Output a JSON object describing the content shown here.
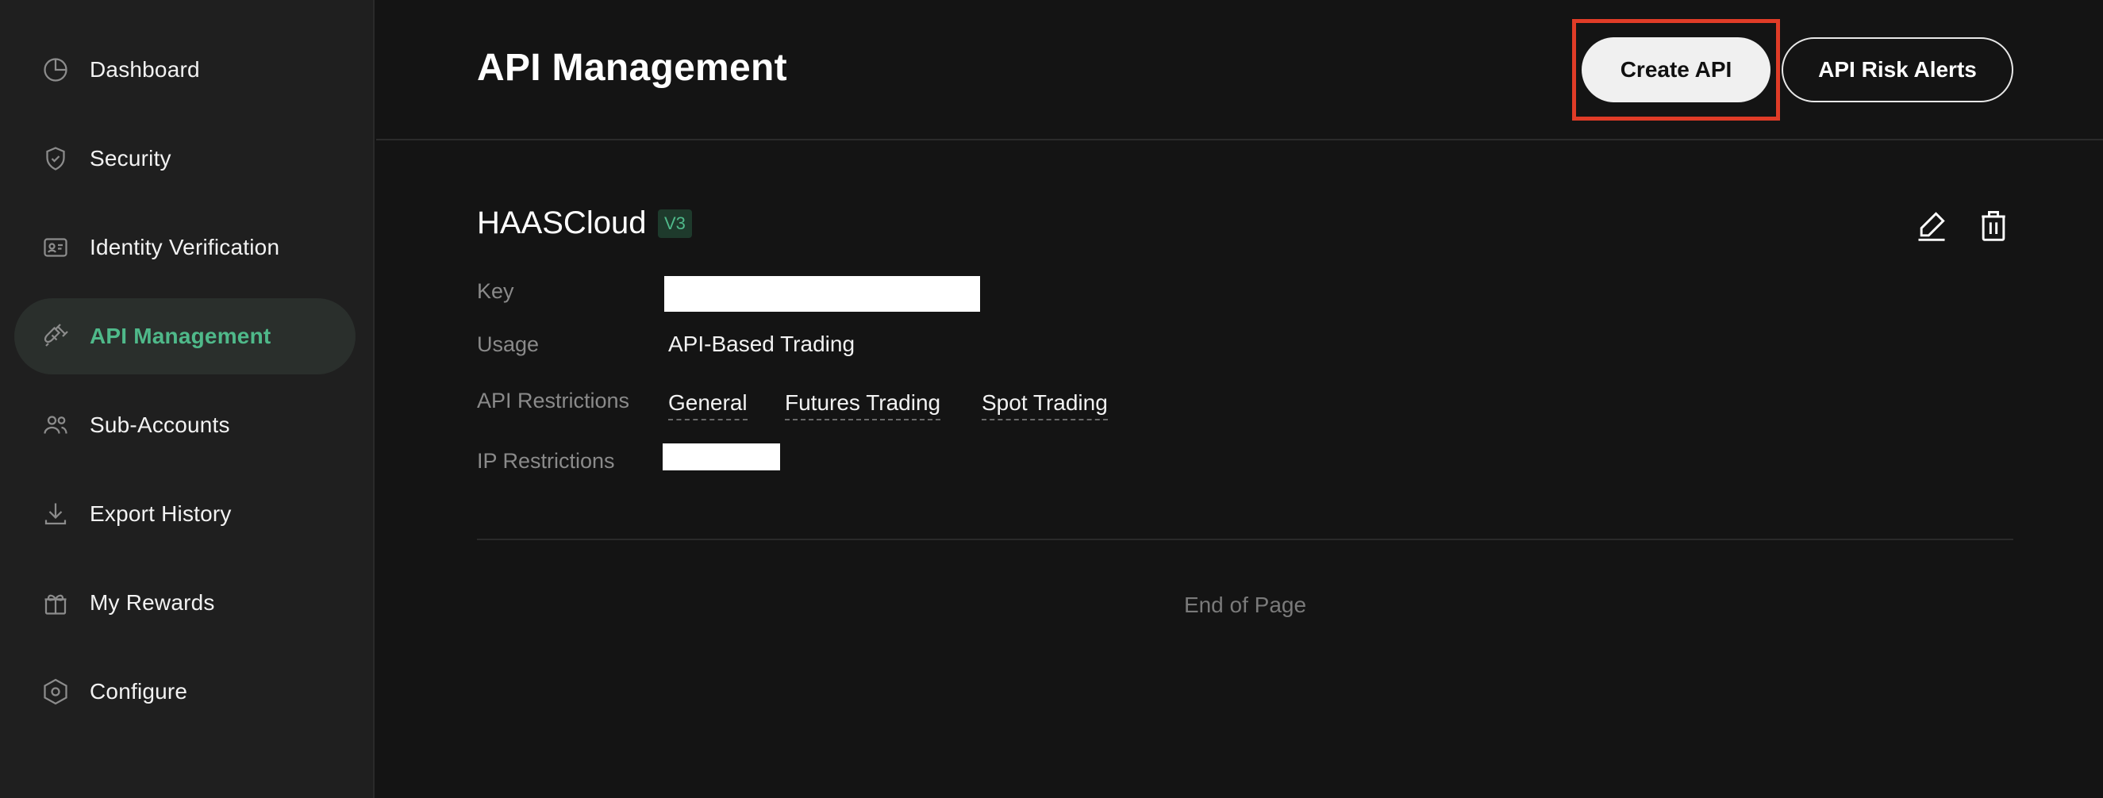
{
  "sidebar": {
    "items": [
      {
        "label": "Dashboard",
        "icon": "pie-chart-icon",
        "active": false
      },
      {
        "label": "Security",
        "icon": "shield-check-icon",
        "active": false
      },
      {
        "label": "Identity Verification",
        "icon": "id-card-icon",
        "active": false
      },
      {
        "label": "API Management",
        "icon": "plug-icon",
        "active": true
      },
      {
        "label": "Sub-Accounts",
        "icon": "users-icon",
        "active": false
      },
      {
        "label": "Export History",
        "icon": "download-icon",
        "active": false
      },
      {
        "label": "My Rewards",
        "icon": "gift-icon",
        "active": false
      },
      {
        "label": "Configure",
        "icon": "hexagon-gear-icon",
        "active": false
      }
    ]
  },
  "header": {
    "title": "API Management",
    "create_button": "Create API",
    "alerts_button": "API Risk Alerts"
  },
  "api_key": {
    "name": "HAASCloud",
    "version": "V3",
    "fields": {
      "key_label": "Key",
      "usage_label": "Usage",
      "usage_value": "API-Based Trading",
      "restrictions_label": "API Restrictions",
      "restrictions": [
        "General",
        "Futures Trading",
        "Spot Trading"
      ],
      "ip_label": "IP Restrictions"
    }
  },
  "footer": {
    "end_text": "End of Page"
  },
  "colors": {
    "accent_green": "#4fb98a",
    "highlight_red": "#e03c27",
    "background": "#141414",
    "sidebar_bg": "#1f1f1f"
  }
}
